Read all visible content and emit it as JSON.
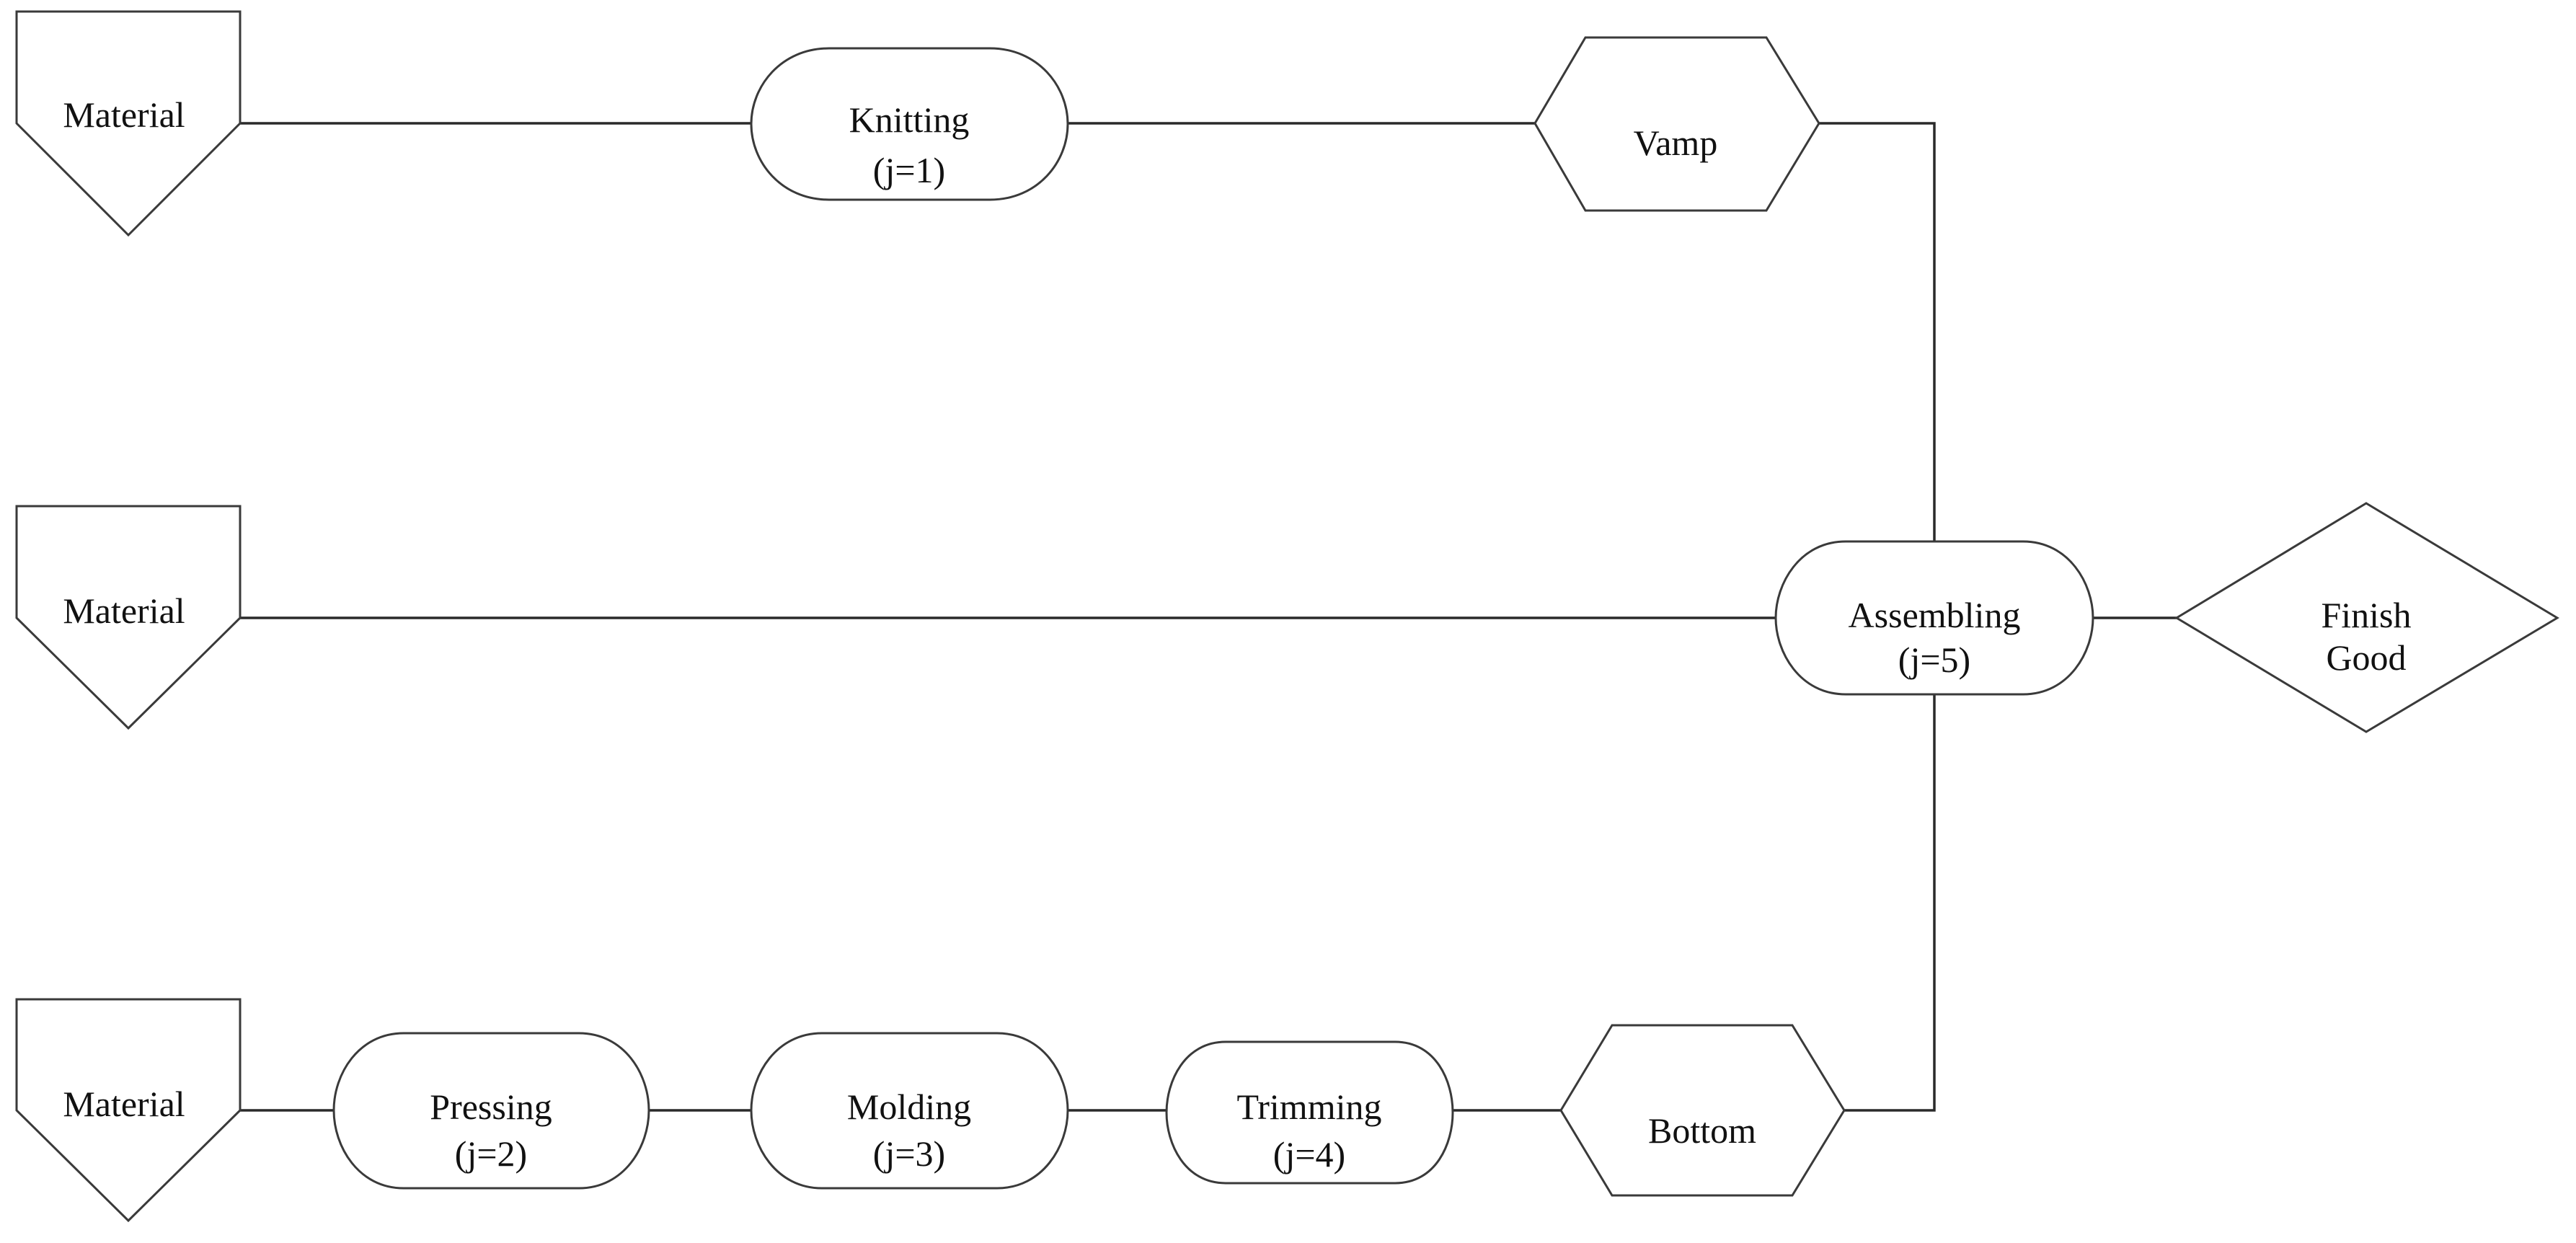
{
  "diagram": {
    "type": "process-flow",
    "colors": {
      "stroke": "#3a3a3a",
      "text": "#111111",
      "background": "#ffffff"
    },
    "nodes": {
      "material_1": {
        "shape": "material-pentagon",
        "lines": [
          "Material"
        ]
      },
      "material_2": {
        "shape": "material-pentagon",
        "lines": [
          "Material"
        ]
      },
      "material_3": {
        "shape": "material-pentagon",
        "lines": [
          "Material"
        ]
      },
      "knitting": {
        "shape": "process-terminator",
        "lines": [
          "Knitting",
          "(j=1)"
        ]
      },
      "pressing": {
        "shape": "process-terminator",
        "lines": [
          "Pressing",
          "(j=2)"
        ]
      },
      "molding": {
        "shape": "process-terminator",
        "lines": [
          "Molding",
          "(j=3)"
        ]
      },
      "trimming": {
        "shape": "process-terminator",
        "lines": [
          "Trimming",
          "(j=4)"
        ]
      },
      "assembling": {
        "shape": "process-terminator",
        "lines": [
          "Assembling",
          "(j=5)"
        ]
      },
      "vamp": {
        "shape": "component-hexagon",
        "lines": [
          "Vamp"
        ]
      },
      "bottom": {
        "shape": "component-hexagon",
        "lines": [
          "Bottom"
        ]
      },
      "finish_good": {
        "shape": "output-diamond",
        "lines": [
          "Finish",
          "Good"
        ]
      }
    },
    "edges": [
      {
        "from": "material_1",
        "to": "knitting"
      },
      {
        "from": "knitting",
        "to": "vamp"
      },
      {
        "from": "vamp",
        "to": "assembling"
      },
      {
        "from": "material_2",
        "to": "assembling"
      },
      {
        "from": "material_3",
        "to": "pressing"
      },
      {
        "from": "pressing",
        "to": "molding"
      },
      {
        "from": "molding",
        "to": "trimming"
      },
      {
        "from": "trimming",
        "to": "bottom"
      },
      {
        "from": "bottom",
        "to": "assembling"
      },
      {
        "from": "assembling",
        "to": "finish_good"
      }
    ]
  }
}
